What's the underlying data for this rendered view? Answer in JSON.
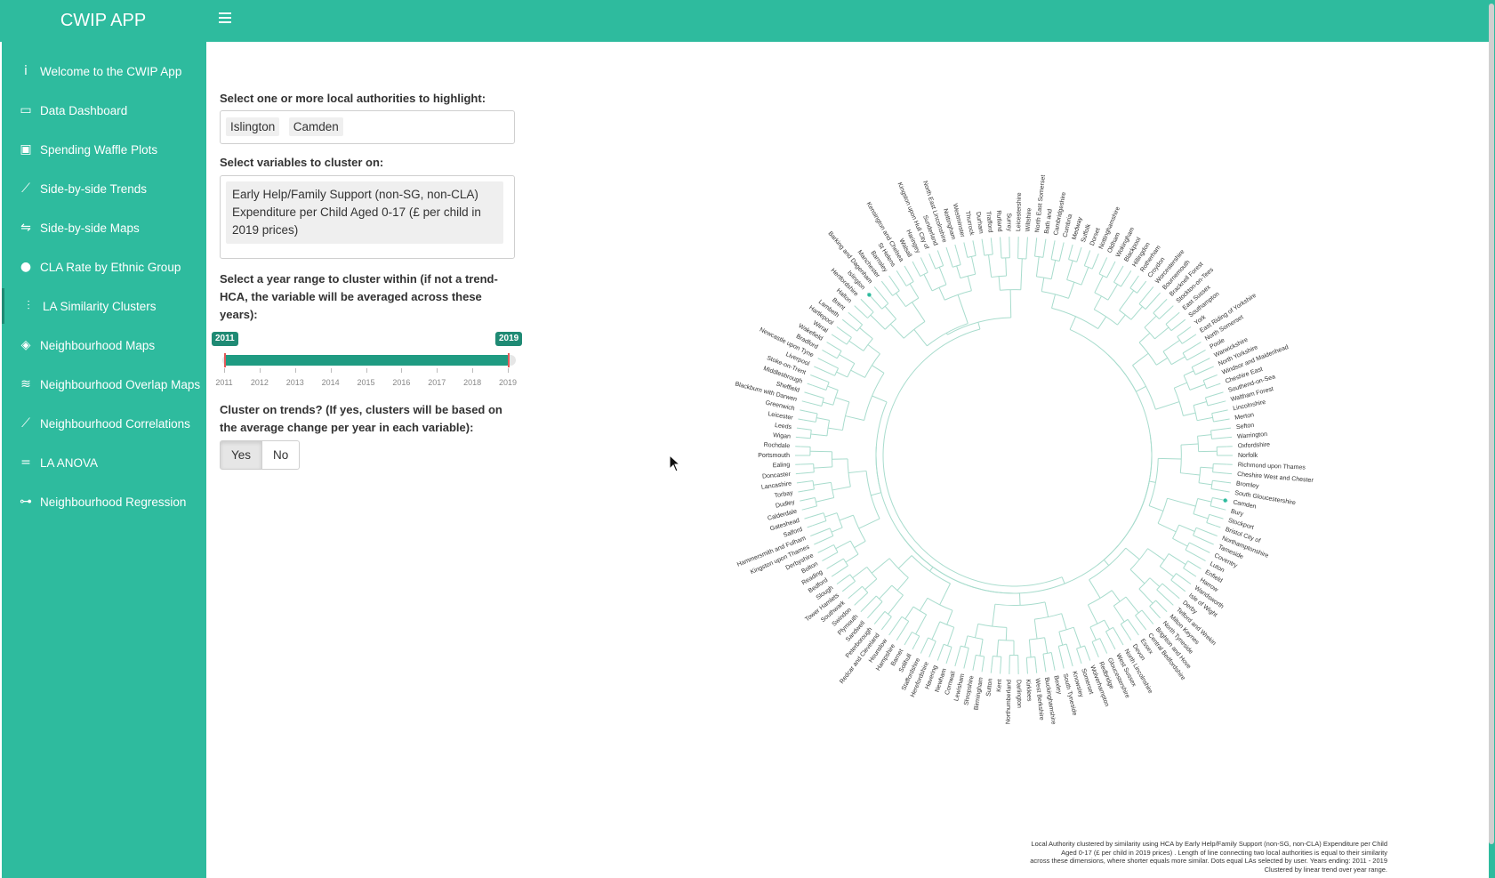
{
  "app": {
    "title": "CWIP APP"
  },
  "sidebar": {
    "items": [
      {
        "label": "Welcome to the CWIP App",
        "icon": "info-icon",
        "glyph": "i"
      },
      {
        "label": "Data Dashboard",
        "icon": "dashboard-icon",
        "glyph": "▭"
      },
      {
        "label": "Spending Waffle Plots",
        "icon": "money-icon",
        "glyph": "▣"
      },
      {
        "label": "Side-by-side Trends",
        "icon": "line-chart-icon",
        "glyph": "⟋"
      },
      {
        "label": "Side-by-side Maps",
        "icon": "signpost-icon",
        "glyph": "⇋"
      },
      {
        "label": "CLA Rate by Ethnic Group",
        "icon": "users-icon",
        "glyph": "●"
      },
      {
        "label": "LA Similarity Clusters",
        "icon": "hierarchy-icon",
        "glyph": "⫶"
      },
      {
        "label": "Neighbourhood Maps",
        "icon": "map-icon",
        "glyph": "◈"
      },
      {
        "label": "Neighbourhood Overlap Maps",
        "icon": "layers-icon",
        "glyph": "≋"
      },
      {
        "label": "Neighbourhood Correlations",
        "icon": "line-chart-icon",
        "glyph": "⟋"
      },
      {
        "label": "LA ANOVA",
        "icon": "equals-icon",
        "glyph": "="
      },
      {
        "label": "Neighbourhood Regression",
        "icon": "network-icon",
        "glyph": "⊶"
      }
    ]
  },
  "controls": {
    "highlight_label": "Select one or more local authorities to highlight:",
    "highlight_values": [
      "Islington",
      "Camden"
    ],
    "variables_label": "Select variables to cluster on:",
    "variable_value": "Early Help/Family Support (non-SG, non-CLA) Expenditure per Child Aged 0-17 (£ per child in 2019 prices)",
    "year_label": "Select a year range to cluster within (if not a trend-HCA, the variable will be averaged across these years):",
    "year_min": "2011",
    "year_max": "2019",
    "year_ticks": [
      "2011",
      "2012",
      "2013",
      "2014",
      "2015",
      "2016",
      "2017",
      "2018",
      "2019"
    ],
    "trends_label": "Cluster on trends? (If yes, clusters will be based on the average change per year in each variable):",
    "trends_options": [
      "Yes",
      "No"
    ],
    "trends_selected": "Yes"
  },
  "chart_data": {
    "type": "dendrogram",
    "layout": "circular",
    "line_color": "#a8dccd",
    "highlight_color": "#2ebb9e",
    "highlighted": [
      "Islington",
      "Camden"
    ],
    "leaves": [
      "North East Somerset",
      "Bath and",
      "Cambridgeshire",
      "Cumbria",
      "Medway",
      "Suffolk",
      "Dorset",
      "Nottinghamshire",
      "Oldham",
      "Wokingham",
      "Blackpool",
      "Hillingdon",
      "Rotherham",
      "Croydon",
      "Worcestershire",
      "Bournemouth",
      "Bracknell Forest",
      "Stockton-on-Tees",
      "East Sussex",
      "Southampton",
      "York",
      "East Riding of Yorkshire",
      "North Somerset",
      "Poole",
      "Warwickshire",
      "North Yorkshire",
      "Windsor and Maidenhead",
      "Cheshire East",
      "Southend-on-Sea",
      "Waltham Forest",
      "Lincolnshire",
      "Merton",
      "Sefton",
      "Warrington",
      "Oxfordshire",
      "Norfolk",
      "Richmond upon Thames",
      "Cheshire West and Chester",
      "Bromley",
      "South Gloucestershire",
      "Camden",
      "Bury",
      "Stockport",
      "Bristol City of",
      "Northamptonshire",
      "Tameside",
      "Coventry",
      "Luton",
      "Enfield",
      "Harrow",
      "Wandsworth",
      "Isle of Wight",
      "Derby",
      "Telford and Wrekin",
      "Milton Keynes",
      "North Tyneside",
      "Brighton and Hove",
      "Central Bedfordshire",
      "Essex",
      "Devon",
      "North Lincolnshire",
      "West Sussex",
      "Gloucestershire",
      "Redbridge",
      "Wolverhampton",
      "Somerset",
      "Knowsley",
      "South Tyneside",
      "Bexley",
      "Buckinghamshire",
      "West Berkshire",
      "Kirklees",
      "Darlington",
      "Northumberland",
      "Kent",
      "Sutton",
      "Birmingham",
      "Shropshire",
      "Lewisham",
      "Cornwall",
      "Newham",
      "Havering",
      "Herefordshire",
      "Staffordshire",
      "Solihull",
      "Barnet",
      "Hampshire",
      "Hounslow",
      "Redcar and Cleveland",
      "Peterborough",
      "Sandwell",
      "Plymouth",
      "Swindon",
      "Southwark",
      "Tower Hamlets",
      "Slough",
      "Bedford",
      "Reading",
      "Bolton",
      "Derbyshire",
      "Kingston upon Thames",
      "Hammersmith and Fulham",
      "Salford",
      "Gateshead",
      "Calderdale",
      "Dudley",
      "Torbay",
      "Lancashire",
      "Doncaster",
      "Ealing",
      "Portsmouth",
      "Rochdale",
      "Wigan",
      "Leeds",
      "Leicester",
      "Greenwich",
      "Blackburn with Darwen",
      "Sheffield",
      "Middlesbrough",
      "Stoke-on-Trent",
      "Liverpool",
      "Newcastle upon Tyne",
      "Bradford",
      "Wakefield",
      "Wirral",
      "Hartlepool",
      "Lambeth",
      "Brent",
      "Halton",
      "Hertfordshire",
      "Islington",
      "Barking and Dagenham",
      "Manchester",
      "Barnsley",
      "St Helens",
      "Kensington and Chelsea",
      "Walsall",
      "Haringey",
      "Kingston upon Hull City of",
      "Sunderland",
      "North East Lincolnshire",
      "Nottingham",
      "Westminster",
      "Thurrock",
      "Durham",
      "Trafford",
      "Rutland",
      "Surrey",
      "Leicestershire",
      "Wiltshire"
    ],
    "caption_lines": [
      "Local Authority clustered by similarity using HCA by Early Help/Family Support (non-SG, non-CLA) Expenditure per Child",
      "Aged 0-17 (£ per child in 2019 prices) . Length of line connecting two local authorities is equal to their similarity",
      "across these dimensions, where shorter equals more similar. Dots equal LAs selected by user. Years ending: 2011 - 2019",
      "Clustered by linear trend over year range."
    ]
  }
}
